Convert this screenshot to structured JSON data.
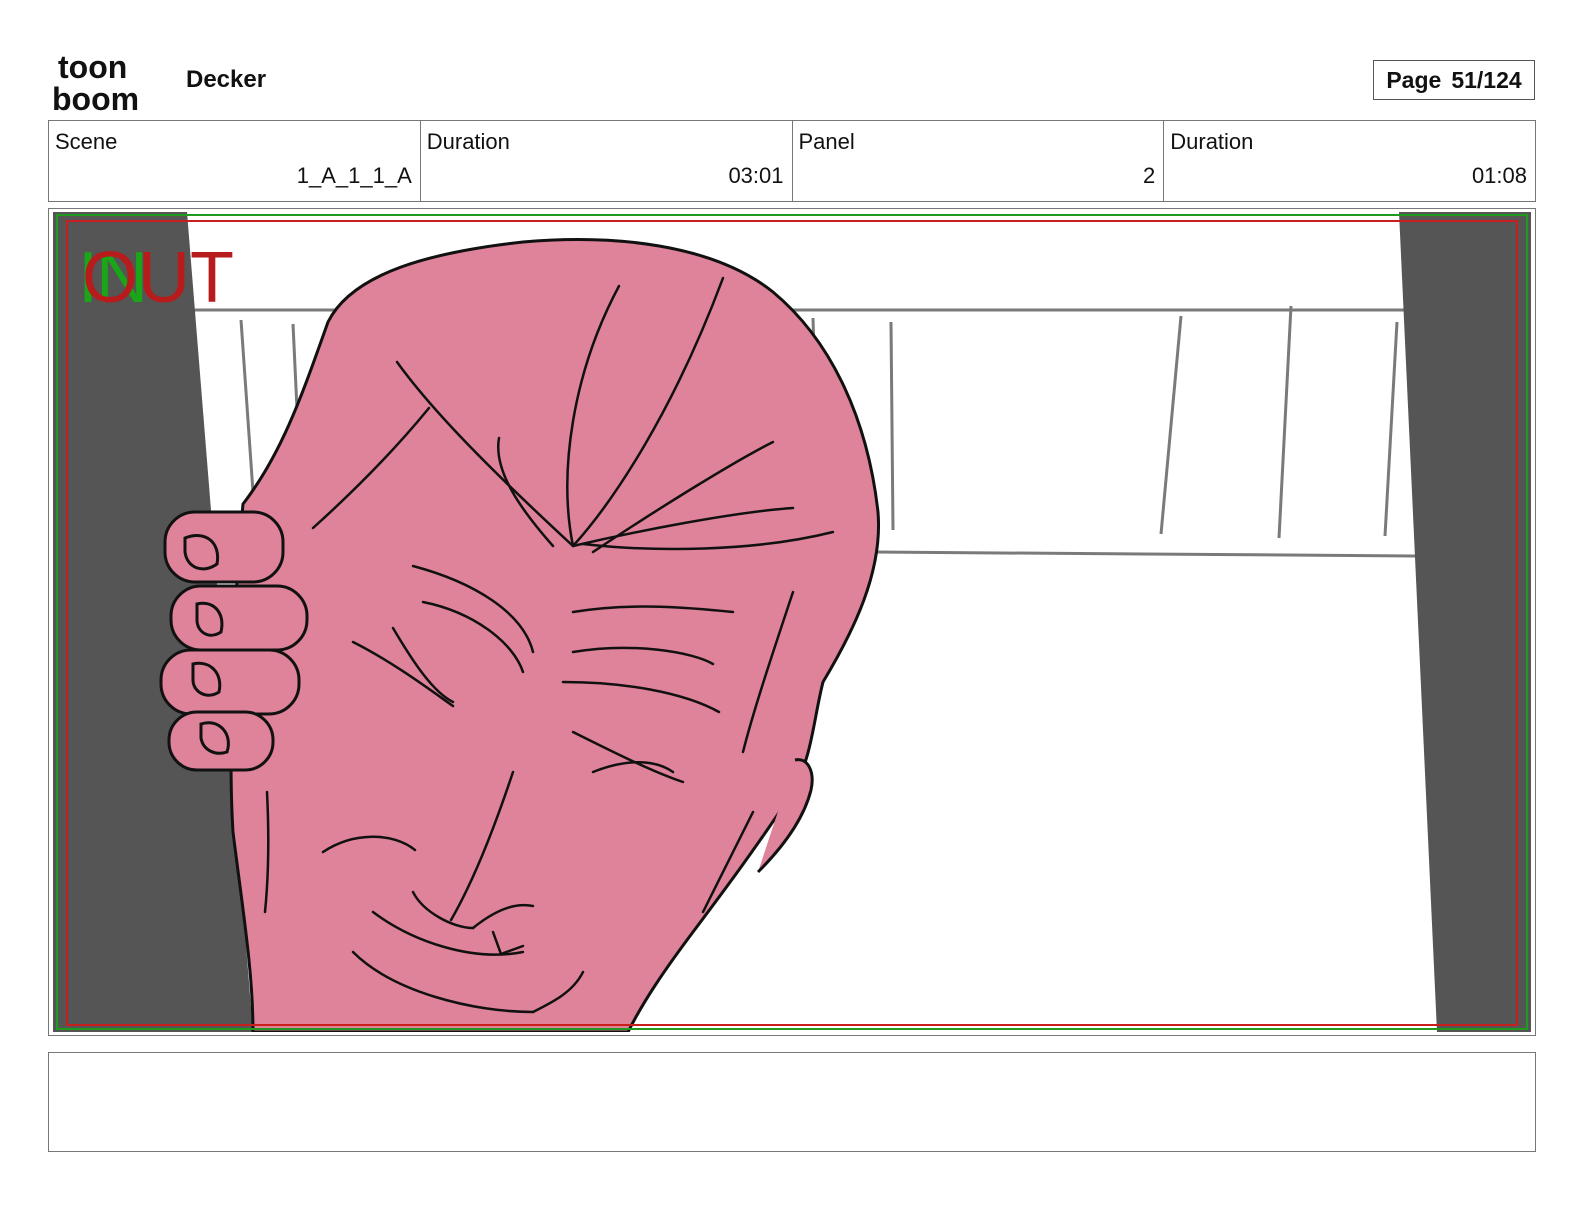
{
  "header": {
    "logo_text_top": "toon",
    "logo_text_bottom": "boom",
    "project_title": "Decker",
    "page_label": "Page",
    "page_number": "51/124"
  },
  "info": {
    "scene_label": "Scene",
    "scene_value": "1_A_1_1_A",
    "scene_duration_label": "Duration",
    "scene_duration_value": "03:01",
    "panel_label": "Panel",
    "panel_value": "2",
    "panel_duration_label": "Duration",
    "panel_duration_value": "01:08"
  },
  "panel": {
    "in_marker": "IN",
    "out_marker": "OUT",
    "colors": {
      "skin": "#de8399",
      "pillar": "#555555",
      "safe_frame_red": "#c81e1e",
      "safe_frame_green": "#1f9a1f"
    }
  },
  "caption": {
    "text": ""
  }
}
